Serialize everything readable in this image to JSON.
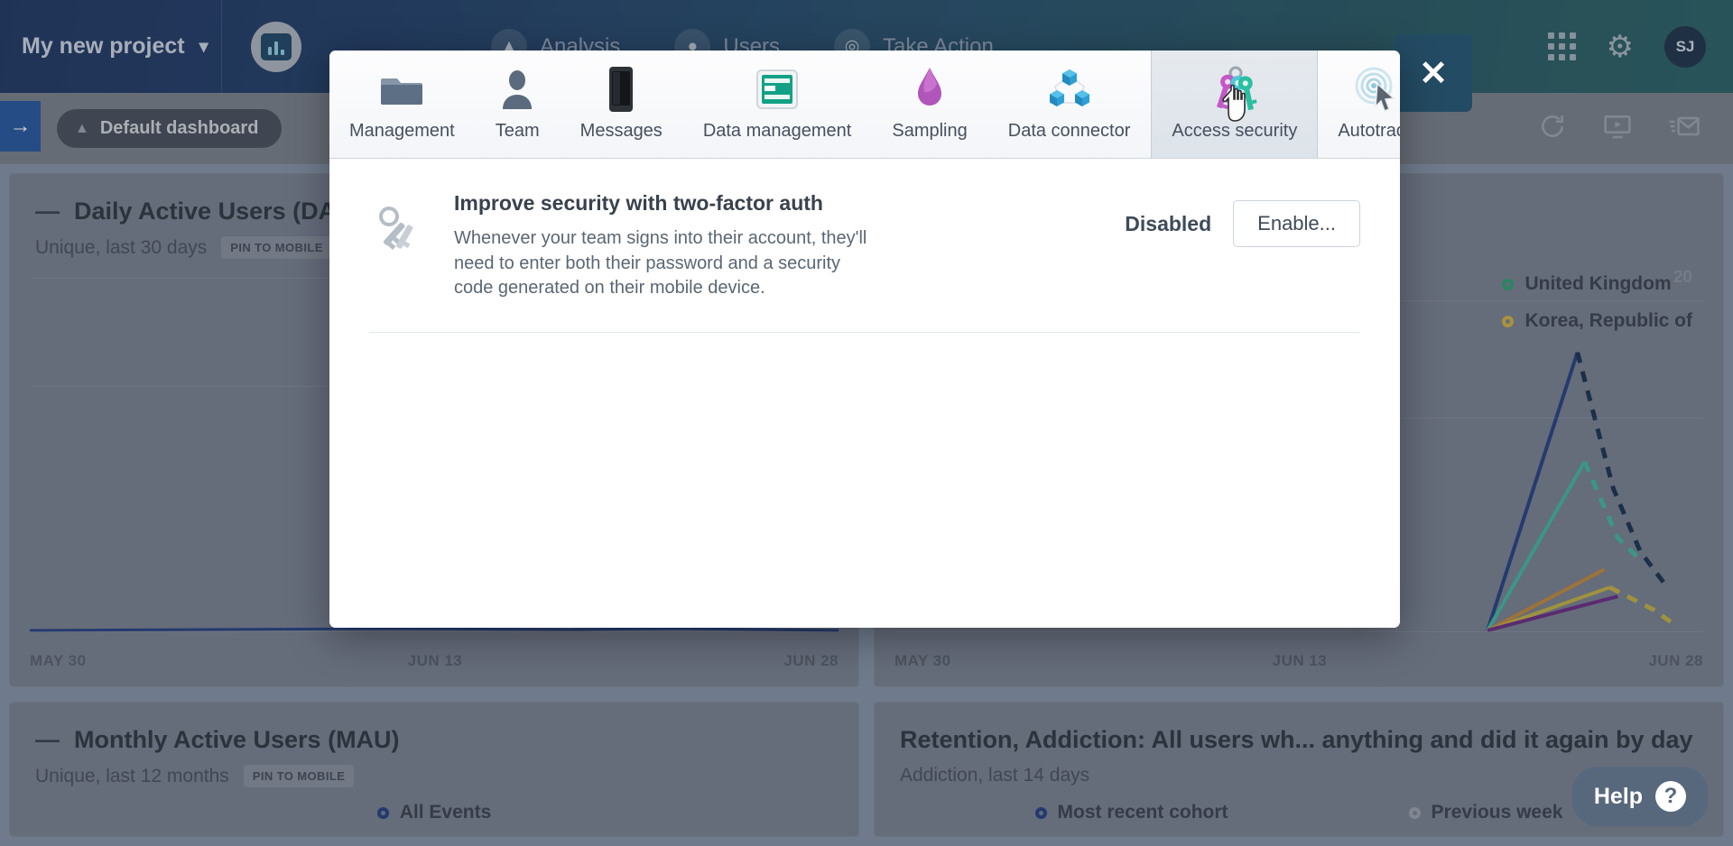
{
  "topbar": {
    "project_name": "My new project",
    "project_chevron": "chevron-down",
    "nav_items": [
      {
        "label": "Analysis",
        "icon": "analysis-icon"
      },
      {
        "label": "Users",
        "icon": "users-icon"
      },
      {
        "label": "Take Action",
        "icon": "take-action-icon"
      }
    ],
    "right_icons": [
      "apps-grid-icon",
      "gear-icon"
    ],
    "avatar_initials": "SJ"
  },
  "subbar": {
    "collapse_label": "→",
    "dashboard_label": "Default dashboard",
    "tools": [
      "refresh-icon",
      "presentation-icon",
      "email-icon"
    ]
  },
  "cards": [
    {
      "title": "Daily Active Users (DAU)",
      "subtitle": "Unique, last 30 days",
      "badge": "PIN TO MOBILE",
      "axis": [
        "MAY 30",
        "JUN 13",
        "JUN 28"
      ]
    },
    {
      "title": "",
      "subtitle": "",
      "badge": "",
      "axis": [
        "MAY 30",
        "JUN 13",
        "JUN 28"
      ],
      "legend": [
        {
          "label": "United Kingdom",
          "color": "#19a974"
        },
        {
          "label": "Korea, Republic of",
          "color": "#d8b229"
        }
      ],
      "axis_value": "20"
    },
    {
      "title": "Monthly Active Users (MAU)",
      "subtitle": "Unique, last 12 months",
      "badge": "PIN TO MOBILE",
      "legend_bottom": [
        {
          "label": "All Events",
          "color": "#23479e"
        }
      ]
    },
    {
      "title": "Retention, Addiction: All users wh... anything and did it again by day",
      "subtitle": "Addiction, last 14 days",
      "badge": "",
      "legend_bottom": [
        {
          "label": "Most recent cohort",
          "color": "#23479e"
        },
        {
          "label": "Previous week",
          "color": "#9aa5b4"
        }
      ]
    }
  ],
  "modal": {
    "close_label": "✕",
    "tabs": [
      {
        "label": "Management",
        "icon": "folder-icon",
        "active": false
      },
      {
        "label": "Team",
        "icon": "person-icon",
        "active": false
      },
      {
        "label": "Messages",
        "icon": "mobile-phone-icon",
        "active": false
      },
      {
        "label": "Data management",
        "icon": "database-card-icon",
        "active": false
      },
      {
        "label": "Sampling",
        "icon": "droplet-icon",
        "active": false
      },
      {
        "label": "Data connector",
        "icon": "cubes-network-icon",
        "active": false
      },
      {
        "label": "Access security",
        "icon": "keys-icon",
        "active": true
      },
      {
        "label": "Autotrack",
        "icon": "radar-cursor-icon",
        "active": false
      }
    ],
    "settings": [
      {
        "icon": "keys-icon",
        "title": "Improve security with two-factor auth",
        "description": "Whenever your team signs into their account, they'll need to enter both their password and a security code generated on their mobile device.",
        "status": "Disabled",
        "button": "Enable..."
      }
    ]
  },
  "help": {
    "label": "Help",
    "icon": "question-mark-icon"
  },
  "colors": {
    "brand_blue": "#1f3f7a",
    "accent_blue": "#1f5fbb",
    "card_bg": "#79849a",
    "modal_bg": "#ffffff"
  }
}
